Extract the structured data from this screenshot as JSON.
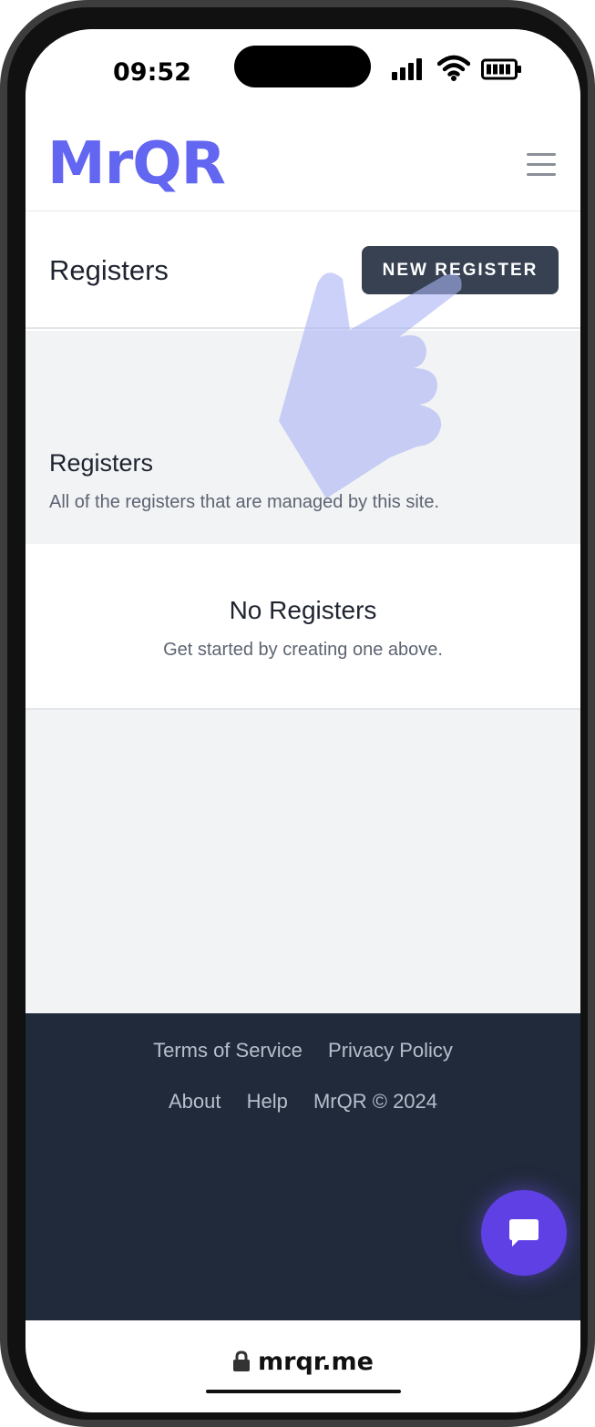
{
  "status_bar": {
    "time": "09:52",
    "icons": [
      "cellular-signal-icon",
      "wifi-icon",
      "battery-icon"
    ]
  },
  "header": {
    "logo_text": "MrQR",
    "menu_icon": "hamburger-menu-icon",
    "brand_color": "#6366f1"
  },
  "page": {
    "title": "Registers",
    "new_button_label": "NEW REGISTER"
  },
  "section": {
    "title": "Registers",
    "description": "All of the registers that are managed by this site."
  },
  "empty_state": {
    "title": "No Registers",
    "description": "Get started by creating one above."
  },
  "footer": {
    "links_row1": [
      "Terms of Service",
      "Privacy Policy"
    ],
    "links_row2": [
      "About",
      "Help"
    ],
    "copyright": "MrQR © 2024"
  },
  "chat": {
    "icon": "chat-bubble-icon",
    "color": "#5f40e4"
  },
  "url_bar": {
    "url": "mrqr.me",
    "icon": "lock-icon"
  },
  "overlay": {
    "icon": "pointing-hand-icon"
  }
}
